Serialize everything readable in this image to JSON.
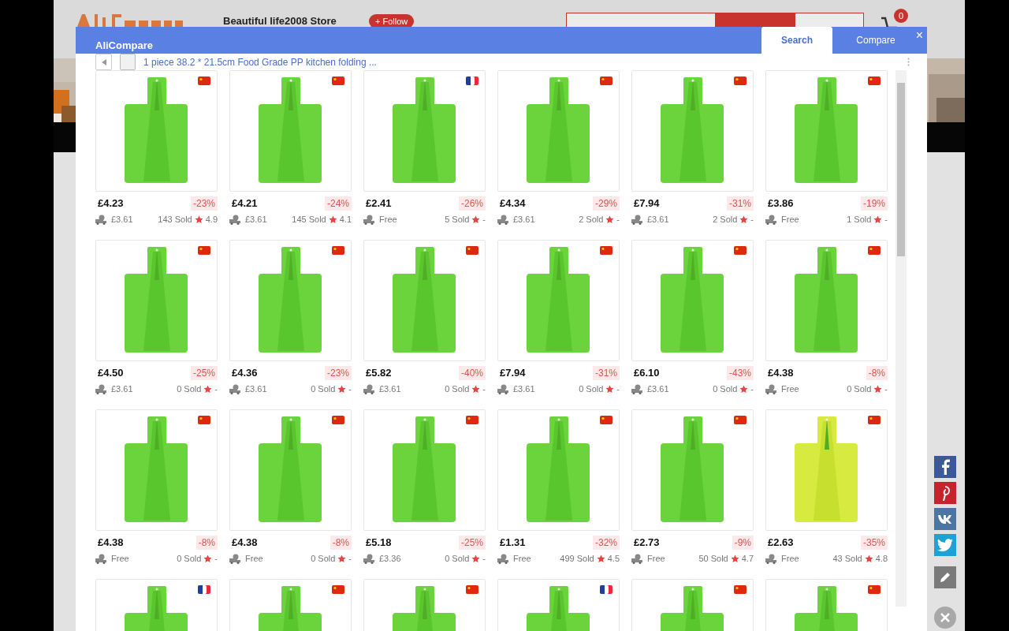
{
  "page": {
    "store_name": "Beautiful life2008 Store",
    "follow_button": "+ Follow",
    "search_scopes": [
      {
        "selected": true
      },
      {
        "selected": false
      }
    ],
    "cart_count": "0"
  },
  "modal": {
    "title": "AliCompare",
    "tabs": [
      {
        "label": "Search",
        "selected": true
      },
      {
        "label": "Compare",
        "selected": false
      }
    ],
    "close": "×",
    "query": "1 piece 38.2 * 21.5cm Food Grade PP kitchen folding ..."
  },
  "products": [
    {
      "kind": "china",
      "price": "£4.23",
      "discount": "-23%",
      "shipping": "£3.61",
      "sold": "143 Sold",
      "rating": "4.9"
    },
    {
      "kind": "china",
      "price": "£4.21",
      "discount": "-24%",
      "shipping": "£3.61",
      "sold": "145 Sold",
      "rating": "4.1"
    },
    {
      "kind": "france",
      "price": "£2.41",
      "discount": "-26%",
      "shipping": "Free",
      "sold": "5 Sold",
      "rating": "-"
    },
    {
      "kind": "china",
      "price": "£4.34",
      "discount": "-29%",
      "shipping": "£3.61",
      "sold": "2 Sold",
      "rating": "-"
    },
    {
      "kind": "china",
      "price": "£7.94",
      "discount": "-31%",
      "shipping": "£3.61",
      "sold": "2 Sold",
      "rating": "-"
    },
    {
      "kind": "china",
      "price": "£3.86",
      "discount": "-19%",
      "shipping": "Free",
      "sold": "1 Sold",
      "rating": "-"
    },
    {
      "kind": "china",
      "price": "£4.50",
      "discount": "-25%",
      "shipping": "£3.61",
      "sold": "0 Sold",
      "rating": "-"
    },
    {
      "kind": "china",
      "price": "£4.36",
      "discount": "-23%",
      "shipping": "£3.61",
      "sold": "0 Sold",
      "rating": "-"
    },
    {
      "kind": "china",
      "price": "£5.82",
      "discount": "-40%",
      "shipping": "£3.61",
      "sold": "0 Sold",
      "rating": "-"
    },
    {
      "kind": "china",
      "price": "£7.94",
      "discount": "-31%",
      "shipping": "£3.61",
      "sold": "0 Sold",
      "rating": "-"
    },
    {
      "kind": "china",
      "price": "£6.10",
      "discount": "-43%",
      "shipping": "£3.61",
      "sold": "0 Sold",
      "rating": "-"
    },
    {
      "kind": "china",
      "price": "£4.38",
      "discount": "-8%",
      "shipping": "Free",
      "sold": "0 Sold",
      "rating": "-"
    },
    {
      "kind": "china",
      "price": "£4.38",
      "discount": "-8%",
      "shipping": "Free",
      "sold": "0 Sold",
      "rating": "-"
    },
    {
      "kind": "china",
      "price": "£4.38",
      "discount": "-8%",
      "shipping": "Free",
      "sold": "0 Sold",
      "rating": "-"
    },
    {
      "kind": "china",
      "price": "£5.18",
      "discount": "-25%",
      "shipping": "£3.36",
      "sold": "0 Sold",
      "rating": "-"
    },
    {
      "kind": "china",
      "price": "£1.31",
      "discount": "-32%",
      "shipping": "Free",
      "sold": "499 Sold",
      "rating": "4.5"
    },
    {
      "kind": "china",
      "price": "£2.73",
      "discount": "-9%",
      "shipping": "Free",
      "sold": "50 Sold",
      "rating": "4.7"
    },
    {
      "kind": "china",
      "price": "£2.63",
      "discount": "-35%",
      "shipping": "Free",
      "sold": "43 Sold",
      "rating": "4.8"
    },
    {
      "kind": "france"
    },
    {
      "kind": "china"
    },
    {
      "kind": "china"
    },
    {
      "kind": "france"
    },
    {
      "kind": "china"
    },
    {
      "kind": "china"
    }
  ]
}
